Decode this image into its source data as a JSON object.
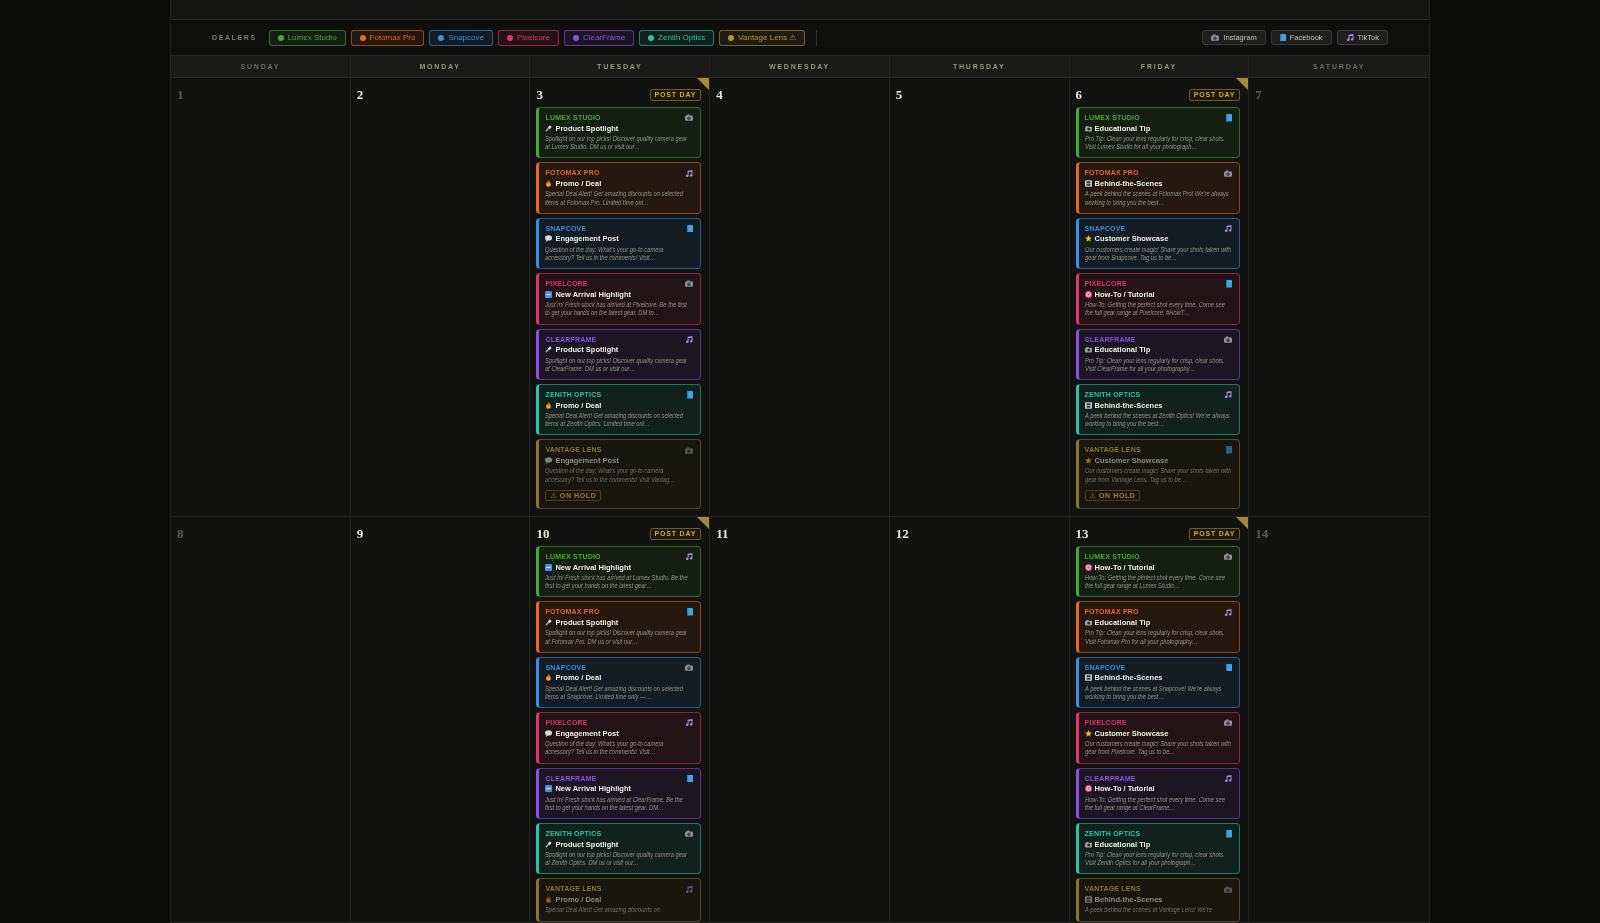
{
  "filters": {
    "label": "DEALERS",
    "dealers": [
      {
        "name": "Lumex Studio",
        "color": "#45a93c"
      },
      {
        "name": "Fotomax Pro",
        "color": "#e8672c"
      },
      {
        "name": "Snapcove",
        "color": "#3b8fe4"
      },
      {
        "name": "Pixelcore",
        "color": "#e0366f"
      },
      {
        "name": "ClearFrame",
        "color": "#8b50e6"
      },
      {
        "name": "Zenith Optics",
        "color": "#2fc2a6"
      },
      {
        "name": "Vantage Lens ⚠",
        "color": "#b8923a"
      }
    ],
    "platforms": [
      {
        "label": "Instagram",
        "kind": "instagram"
      },
      {
        "label": "Facebook",
        "kind": "facebook"
      },
      {
        "label": "TikTok",
        "kind": "tiktok"
      }
    ]
  },
  "calendar": {
    "weekdays": [
      {
        "label": "SUNDAY",
        "weekend": true
      },
      {
        "label": "MONDAY",
        "weekend": false
      },
      {
        "label": "TUESDAY",
        "weekend": false
      },
      {
        "label": "WEDNESDAY",
        "weekend": false
      },
      {
        "label": "THURSDAY",
        "weekend": false
      },
      {
        "label": "FRIDAY",
        "weekend": false
      },
      {
        "label": "SATURDAY",
        "weekend": true
      }
    ],
    "weeks": [
      {
        "days": [
          {
            "number": "1",
            "post_day": false
          },
          {
            "number": "2",
            "post_day": false
          },
          {
            "number": "3",
            "post_day": true,
            "badge": "POST DAY",
            "posts": [
              {
                "dealer": "LUMEX STUDIO",
                "color": "#45a93c",
                "platform": {
                  "kind": "instagram"
                },
                "kind": "spotlight",
                "title": "Product Spotlight",
                "description": "Spotlight on our top picks! Discover quality camera gear at Lumex Studio. DM us or visit our…",
                "on_hold": false
              },
              {
                "dealer": "FOTOMAX PRO",
                "color": "#e8672c",
                "platform": {
                  "kind": "tiktok"
                },
                "kind": "promo",
                "title": "Promo / Deal",
                "description": "Special Deal Alert! Get amazing discounts on selected items at Fotomax Pro. Limited time onl…",
                "on_hold": false
              },
              {
                "dealer": "SNAPCOVE",
                "color": "#3b8fe4",
                "platform": {
                  "kind": "facebook"
                },
                "kind": "engagement",
                "title": "Engagement Post",
                "description": "Question of the day: What's your go-to camera accessory? Tell us in the comments! Visit…",
                "on_hold": false
              },
              {
                "dealer": "PIXELCORE",
                "color": "#e0366f",
                "platform": {
                  "kind": "instagram"
                },
                "kind": "arrival",
                "title": "New Arrival Highlight",
                "description": "Just In! Fresh stock has arrived at Pixelcore. Be the first to get your hands on the latest gear. DM to…",
                "on_hold": false
              },
              {
                "dealer": "CLEARFRAME",
                "color": "#8b50e6",
                "platform": {
                  "kind": "tiktok"
                },
                "kind": "spotlight",
                "title": "Product Spotlight",
                "description": "Spotlight on our top picks! Discover quality camera gear at ClearFrame. DM us or visit our…",
                "on_hold": false
              },
              {
                "dealer": "ZENITH OPTICS",
                "color": "#2fc2a6",
                "platform": {
                  "kind": "facebook"
                },
                "kind": "promo",
                "title": "Promo / Deal",
                "description": "Special Deal Alert! Get amazing discounts on selected items at Zenith Optics. Limited time onl…",
                "on_hold": false
              },
              {
                "dealer": "VANTAGE LENS",
                "color": "#8a7535",
                "platform": {
                  "kind": "instagram"
                },
                "kind": "engagement",
                "title": "Engagement Post",
                "description": "Question of the day: What's your go-to camera accessory? Tell us in the comments! Visit Vantag…",
                "on_hold": true,
                "hold_label": "⚠ ON HOLD"
              }
            ]
          },
          {
            "number": "4",
            "post_day": false
          },
          {
            "number": "5",
            "post_day": false
          },
          {
            "number": "6",
            "post_day": true,
            "badge": "POST DAY",
            "posts": [
              {
                "dealer": "LUMEX STUDIO",
                "color": "#45a93c",
                "platform": {
                  "kind": "facebook"
                },
                "kind": "tip",
                "title": "Educational Tip",
                "description": "Pro Tip: Clean your lens regularly for crisp, clear shots. Visit Lumex Studio for all your photograph…",
                "on_hold": false
              },
              {
                "dealer": "FOTOMAX PRO",
                "color": "#e8672c",
                "platform": {
                  "kind": "instagram"
                },
                "kind": "behind",
                "title": "Behind-the-Scenes",
                "description": "A peek behind the scenes at Fotomax Pro! We're always working to bring you the best…",
                "on_hold": false
              },
              {
                "dealer": "SNAPCOVE",
                "color": "#3b8fe4",
                "platform": {
                  "kind": "tiktok"
                },
                "kind": "showcase",
                "title": "Customer Showcase",
                "description": "Our customers create magic! Share your shots taken with gear from Snapcove. Tag us to be…",
                "on_hold": false
              },
              {
                "dealer": "PIXELCORE",
                "color": "#e0366f",
                "platform": {
                  "kind": "facebook"
                },
                "kind": "tutorial",
                "title": "How-To / Tutorial",
                "description": "How-To: Getting the perfect shot every time. Come see the full gear range at Pixelcore. #HowT…",
                "on_hold": false
              },
              {
                "dealer": "CLEARFRAME",
                "color": "#8b50e6",
                "platform": {
                  "kind": "instagram"
                },
                "kind": "tip",
                "title": "Educational Tip",
                "description": "Pro Tip: Clean your lens regularly for crisp, clear shots. Visit ClearFrame for all your photography…",
                "on_hold": false
              },
              {
                "dealer": "ZENITH OPTICS",
                "color": "#2fc2a6",
                "platform": {
                  "kind": "tiktok"
                },
                "kind": "behind",
                "title": "Behind-the-Scenes",
                "description": "A peek behind the scenes at Zenith Optics! We're always working to bring you the best…",
                "on_hold": false
              },
              {
                "dealer": "VANTAGE LENS",
                "color": "#8a7535",
                "platform": {
                  "kind": "facebook"
                },
                "kind": "showcase",
                "title": "Customer Showcase",
                "description": "Our customers create magic! Share your shots taken with gear from Vantage Lens. Tag us to be…",
                "on_hold": true,
                "hold_label": "⚠ ON HOLD"
              }
            ]
          },
          {
            "number": "7",
            "post_day": false
          }
        ]
      },
      {
        "days": [
          {
            "number": "8",
            "post_day": false
          },
          {
            "number": "9",
            "post_day": false
          },
          {
            "number": "10",
            "post_day": true,
            "badge": "POST DAY",
            "posts": [
              {
                "dealer": "LUMEX STUDIO",
                "color": "#45a93c",
                "platform": {
                  "kind": "tiktok"
                },
                "kind": "arrival",
                "title": "New Arrival Highlight",
                "description": "Just In! Fresh stock has arrived at Lumex Studio. Be the first to get your hands on the latest gear…",
                "on_hold": false
              },
              {
                "dealer": "FOTOMAX PRO",
                "color": "#e8672c",
                "platform": {
                  "kind": "facebook"
                },
                "kind": "spotlight",
                "title": "Product Spotlight",
                "description": "Spotlight on our top picks! Discover quality camera gear at Fotomax Pro. DM us or visit our…",
                "on_hold": false
              },
              {
                "dealer": "SNAPCOVE",
                "color": "#3b8fe4",
                "platform": {
                  "kind": "instagram"
                },
                "kind": "promo",
                "title": "Promo / Deal",
                "description": "Special Deal Alert! Get amazing discounts on selected items at Snapcove. Limited time only —…",
                "on_hold": false
              },
              {
                "dealer": "PIXELCORE",
                "color": "#e0366f",
                "platform": {
                  "kind": "tiktok"
                },
                "kind": "engagement",
                "title": "Engagement Post",
                "description": "Question of the day: What's your go-to camera accessory? Tell us in the comments! Visit…",
                "on_hold": false
              },
              {
                "dealer": "CLEARFRAME",
                "color": "#8b50e6",
                "platform": {
                  "kind": "facebook"
                },
                "kind": "arrival",
                "title": "New Arrival Highlight",
                "description": "Just In! Fresh stock has arrived at ClearFrame. Be the first to get your hands on the latest gear. DM…",
                "on_hold": false
              },
              {
                "dealer": "ZENITH OPTICS",
                "color": "#2fc2a6",
                "platform": {
                  "kind": "instagram"
                },
                "kind": "spotlight",
                "title": "Product Spotlight",
                "description": "Spotlight on our top picks! Discover quality camera gear at Zenith Optics. DM us or visit our…",
                "on_hold": false
              },
              {
                "dealer": "VANTAGE LENS",
                "color": "#8a7535",
                "platform": {
                  "kind": "tiktok"
                },
                "kind": "promo",
                "title": "Promo / Deal",
                "description": "Special Deal Alert! Get amazing discounts on",
                "on_hold": true
              }
            ]
          },
          {
            "number": "11",
            "post_day": false
          },
          {
            "number": "12",
            "post_day": false
          },
          {
            "number": "13",
            "post_day": true,
            "badge": "POST DAY",
            "posts": [
              {
                "dealer": "LUMEX STUDIO",
                "color": "#45a93c",
                "platform": {
                  "kind": "instagram"
                },
                "kind": "tutorial",
                "title": "How-To / Tutorial",
                "description": "How-To: Getting the perfect shot every time. Come see the full gear range at Lumex Studio…",
                "on_hold": false
              },
              {
                "dealer": "FOTOMAX PRO",
                "color": "#e8672c",
                "platform": {
                  "kind": "tiktok"
                },
                "kind": "tip",
                "title": "Educational Tip",
                "description": "Pro Tip: Clean your lens regularly for crisp, clear shots. Visit Fotomax Pro for all your photography…",
                "on_hold": false
              },
              {
                "dealer": "SNAPCOVE",
                "color": "#3b8fe4",
                "platform": {
                  "kind": "facebook"
                },
                "kind": "behind",
                "title": "Behind-the-Scenes",
                "description": "A peek behind the scenes at Snapcove! We're always working to bring you the best…",
                "on_hold": false
              },
              {
                "dealer": "PIXELCORE",
                "color": "#e0366f",
                "platform": {
                  "kind": "instagram"
                },
                "kind": "showcase",
                "title": "Customer Showcase",
                "description": "Our customers create magic! Share your shots taken with gear from Pixelcore. Tag us to be…",
                "on_hold": false
              },
              {
                "dealer": "CLEARFRAME",
                "color": "#8b50e6",
                "platform": {
                  "kind": "tiktok"
                },
                "kind": "tutorial",
                "title": "How-To / Tutorial",
                "description": "How-To: Getting the perfect shot every time. Come see the full gear range at ClearFrame…",
                "on_hold": false
              },
              {
                "dealer": "ZENITH OPTICS",
                "color": "#2fc2a6",
                "platform": {
                  "kind": "facebook"
                },
                "kind": "tip",
                "title": "Educational Tip",
                "description": "Pro Tip: Clean your lens regularly for crisp, clear shots. Visit Zenith Optics for all your photograph…",
                "on_hold": false
              },
              {
                "dealer": "VANTAGE LENS",
                "color": "#8a7535",
                "platform": {
                  "kind": "instagram"
                },
                "kind": "behind",
                "title": "Behind-the-Scenes",
                "description": "A peek behind the scenes at Vantage Lens! We're",
                "on_hold": true
              }
            ]
          },
          {
            "number": "14",
            "post_day": false
          }
        ]
      }
    ]
  }
}
